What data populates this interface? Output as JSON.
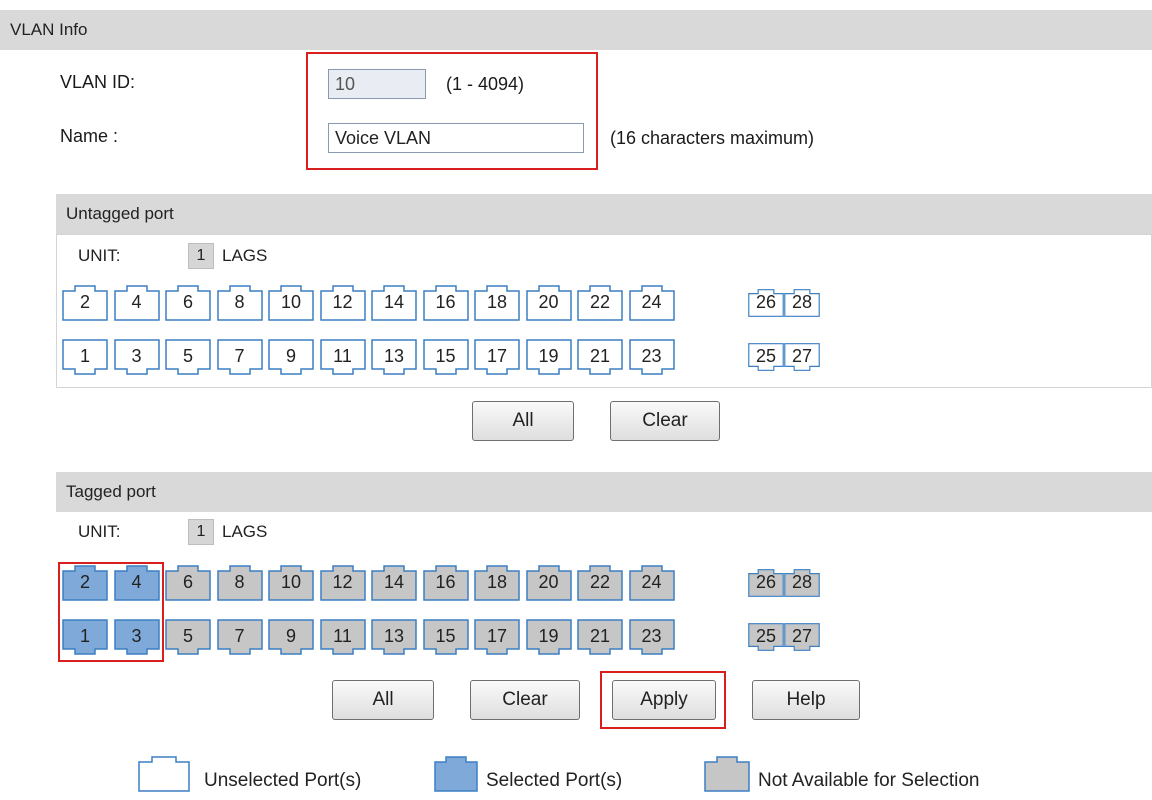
{
  "section_title": "VLAN Info",
  "form": {
    "vlan_id_label": "VLAN ID:",
    "vlan_id_value": "10",
    "vlan_id_hint": "(1 - 4094)",
    "name_label": "Name :",
    "name_value": "Voice VLAN",
    "name_hint": "(16 characters maximum)"
  },
  "untagged": {
    "title": "Untagged port",
    "unit_label": "UNIT:",
    "unit_value": "1",
    "lags_label": "LAGS",
    "top_ports": [
      {
        "label": "2",
        "state": "unselected"
      },
      {
        "label": "4",
        "state": "unselected"
      },
      {
        "label": "6",
        "state": "unselected"
      },
      {
        "label": "8",
        "state": "unselected"
      },
      {
        "label": "10",
        "state": "unselected"
      },
      {
        "label": "12",
        "state": "unselected"
      },
      {
        "label": "14",
        "state": "unselected"
      },
      {
        "label": "16",
        "state": "unselected"
      },
      {
        "label": "18",
        "state": "unselected"
      },
      {
        "label": "20",
        "state": "unselected"
      },
      {
        "label": "22",
        "state": "unselected"
      },
      {
        "label": "24",
        "state": "unselected"
      }
    ],
    "top_extra": [
      {
        "label": "26",
        "state": "unselected"
      },
      {
        "label": "28",
        "state": "unselected"
      }
    ],
    "bottom_ports": [
      {
        "label": "1",
        "state": "unselected"
      },
      {
        "label": "3",
        "state": "unselected"
      },
      {
        "label": "5",
        "state": "unselected"
      },
      {
        "label": "7",
        "state": "unselected"
      },
      {
        "label": "9",
        "state": "unselected"
      },
      {
        "label": "11",
        "state": "unselected"
      },
      {
        "label": "13",
        "state": "unselected"
      },
      {
        "label": "15",
        "state": "unselected"
      },
      {
        "label": "17",
        "state": "unselected"
      },
      {
        "label": "19",
        "state": "unselected"
      },
      {
        "label": "21",
        "state": "unselected"
      },
      {
        "label": "23",
        "state": "unselected"
      }
    ],
    "bottom_extra": [
      {
        "label": "25",
        "state": "unselected"
      },
      {
        "label": "27",
        "state": "unselected"
      }
    ],
    "all_button": "All",
    "clear_button": "Clear"
  },
  "tagged": {
    "title": "Tagged port",
    "unit_label": "UNIT:",
    "unit_value": "1",
    "lags_label": "LAGS",
    "top_ports": [
      {
        "label": "2",
        "state": "selected"
      },
      {
        "label": "4",
        "state": "selected"
      },
      {
        "label": "6",
        "state": "unavailable"
      },
      {
        "label": "8",
        "state": "unavailable"
      },
      {
        "label": "10",
        "state": "unavailable"
      },
      {
        "label": "12",
        "state": "unavailable"
      },
      {
        "label": "14",
        "state": "unavailable"
      },
      {
        "label": "16",
        "state": "unavailable"
      },
      {
        "label": "18",
        "state": "unavailable"
      },
      {
        "label": "20",
        "state": "unavailable"
      },
      {
        "label": "22",
        "state": "unavailable"
      },
      {
        "label": "24",
        "state": "unavailable"
      }
    ],
    "top_extra": [
      {
        "label": "26",
        "state": "unavailable"
      },
      {
        "label": "28",
        "state": "unavailable"
      }
    ],
    "bottom_ports": [
      {
        "label": "1",
        "state": "selected"
      },
      {
        "label": "3",
        "state": "selected"
      },
      {
        "label": "5",
        "state": "unavailable"
      },
      {
        "label": "7",
        "state": "unavailable"
      },
      {
        "label": "9",
        "state": "unavailable"
      },
      {
        "label": "11",
        "state": "unavailable"
      },
      {
        "label": "13",
        "state": "unavailable"
      },
      {
        "label": "15",
        "state": "unavailable"
      },
      {
        "label": "17",
        "state": "unavailable"
      },
      {
        "label": "19",
        "state": "unavailable"
      },
      {
        "label": "21",
        "state": "unavailable"
      },
      {
        "label": "23",
        "state": "unavailable"
      }
    ],
    "bottom_extra": [
      {
        "label": "25",
        "state": "unavailable"
      },
      {
        "label": "27",
        "state": "unavailable"
      }
    ],
    "all_button": "All",
    "clear_button": "Clear",
    "apply_button": "Apply",
    "help_button": "Help"
  },
  "legend": {
    "unselected": "Unselected Port(s)",
    "selected": "Selected Port(s)",
    "unavailable": "Not Available for Selection"
  },
  "colors": {
    "unselected_fill": "#ffffff",
    "selected_fill": "#7fa9d8",
    "unavailable_fill": "#c6c6c6",
    "port_border": "#3b7fc4",
    "highlight_red": "#d91e1e"
  }
}
